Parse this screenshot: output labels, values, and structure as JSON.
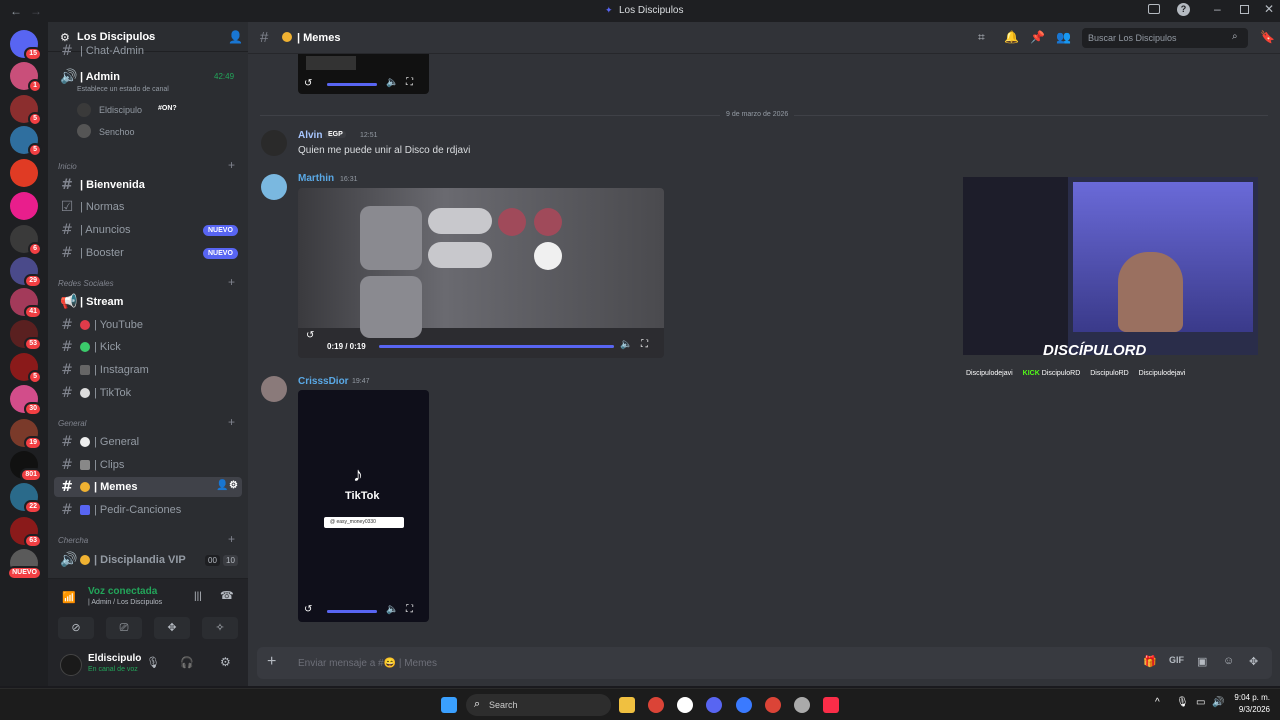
{
  "window": {
    "title": "Los Discipulos"
  },
  "servers": [
    {
      "badge": "15",
      "color": "#5865f2"
    },
    {
      "badge": "1",
      "color": "#c94f7a"
    },
    {
      "badge": "5",
      "color": "#8b2e2e"
    },
    {
      "badge": "5",
      "color": "#2f6f9f"
    },
    {
      "badge": "",
      "color": "#e03b24"
    },
    {
      "badge": "",
      "color": "#e91e8c"
    },
    {
      "badge": "6",
      "color": "#3a3a3a"
    },
    {
      "badge": "29",
      "color": "#4a4a8a"
    },
    {
      "badge": "41",
      "color": "#a33a5a"
    },
    {
      "badge": "53",
      "color": "#5a2020"
    },
    {
      "badge": "5",
      "color": "#8a1a1a"
    },
    {
      "badge": "30",
      "color": "#d24d8a"
    },
    {
      "badge": "19",
      "color": "#7a3a2a"
    },
    {
      "badge": "801",
      "color": "#111111"
    },
    {
      "badge": "22",
      "color": "#2a6a8a"
    },
    {
      "badge": "63",
      "color": "#8a1a1a"
    },
    {
      "badge": "NUEVO",
      "color": "#5a5a5a"
    }
  ],
  "sidebar": {
    "server_name": "Los Discipulos",
    "top_channel": "| Chat-Admin",
    "voice": {
      "name": "| Admin",
      "time": "42:49",
      "status": "Establece un estado de canal",
      "members": [
        {
          "name": "Eldiscipulo",
          "tag": "#ON?"
        },
        {
          "name": "Senchoo"
        }
      ]
    },
    "categories": {
      "inicio": "Inicio",
      "redes": "Redes Sociales",
      "general": "General",
      "chercha": "Chercha"
    },
    "channels": {
      "bienvenida": "| Bienvenida",
      "normas": "| Normas",
      "anuncios": "| Anuncios",
      "booster": "| Booster",
      "stream": "| Stream",
      "youtube": "| YouTube",
      "kick": "| Kick",
      "instagram": "| Instagram",
      "tiktok": "| TikTok",
      "general": "| General",
      "clips": "| Clips",
      "memes": "| Memes",
      "pedir": "| Pedir-Canciones",
      "vip": "| Disciplandia VIP",
      "vip_count1": "00",
      "vip_count2": "10"
    },
    "nuevo": "NUEVO",
    "voice_panel": {
      "status": "Voz conectada",
      "channel": "| Admin / Los Discipulos"
    },
    "user": {
      "name": "Eldiscipulo",
      "status": "En canal de voz"
    }
  },
  "header": {
    "channel": "| Memes",
    "search_placeholder": "Buscar Los Discipulos"
  },
  "messages": {
    "date_divider": "9 de marzo de 2026",
    "alvin": {
      "name": "Alvin",
      "tag": "EGP",
      "time": "12:51",
      "text": "Quien me puede unir al Disco de rdjavi"
    },
    "marthin": {
      "name": "Marthin",
      "time": "16:31",
      "video_time": "0:19 / 0:19",
      "video_progress": 1.0
    },
    "criss": {
      "name": "CrisssDior",
      "time": "19:47",
      "tiktok_label": "TikTok",
      "tiktok_handle": "@ easy_money0330"
    },
    "top_video_progress": 1.0,
    "criss_video_progress": 1.0
  },
  "stream_overlay": {
    "brand": "DISCÍPULORD",
    "socials": [
      "Discipulodejavi",
      "DiscipuloRD",
      "DiscipuloRD",
      "Discipulodejavi"
    ],
    "kick_label": "KICK"
  },
  "composer": {
    "placeholder": "Enviar mensaje a #😄 | Memes"
  },
  "taskbar": {
    "search": "Search",
    "time": "9:04 p. m.",
    "date": "9/3/2026"
  }
}
